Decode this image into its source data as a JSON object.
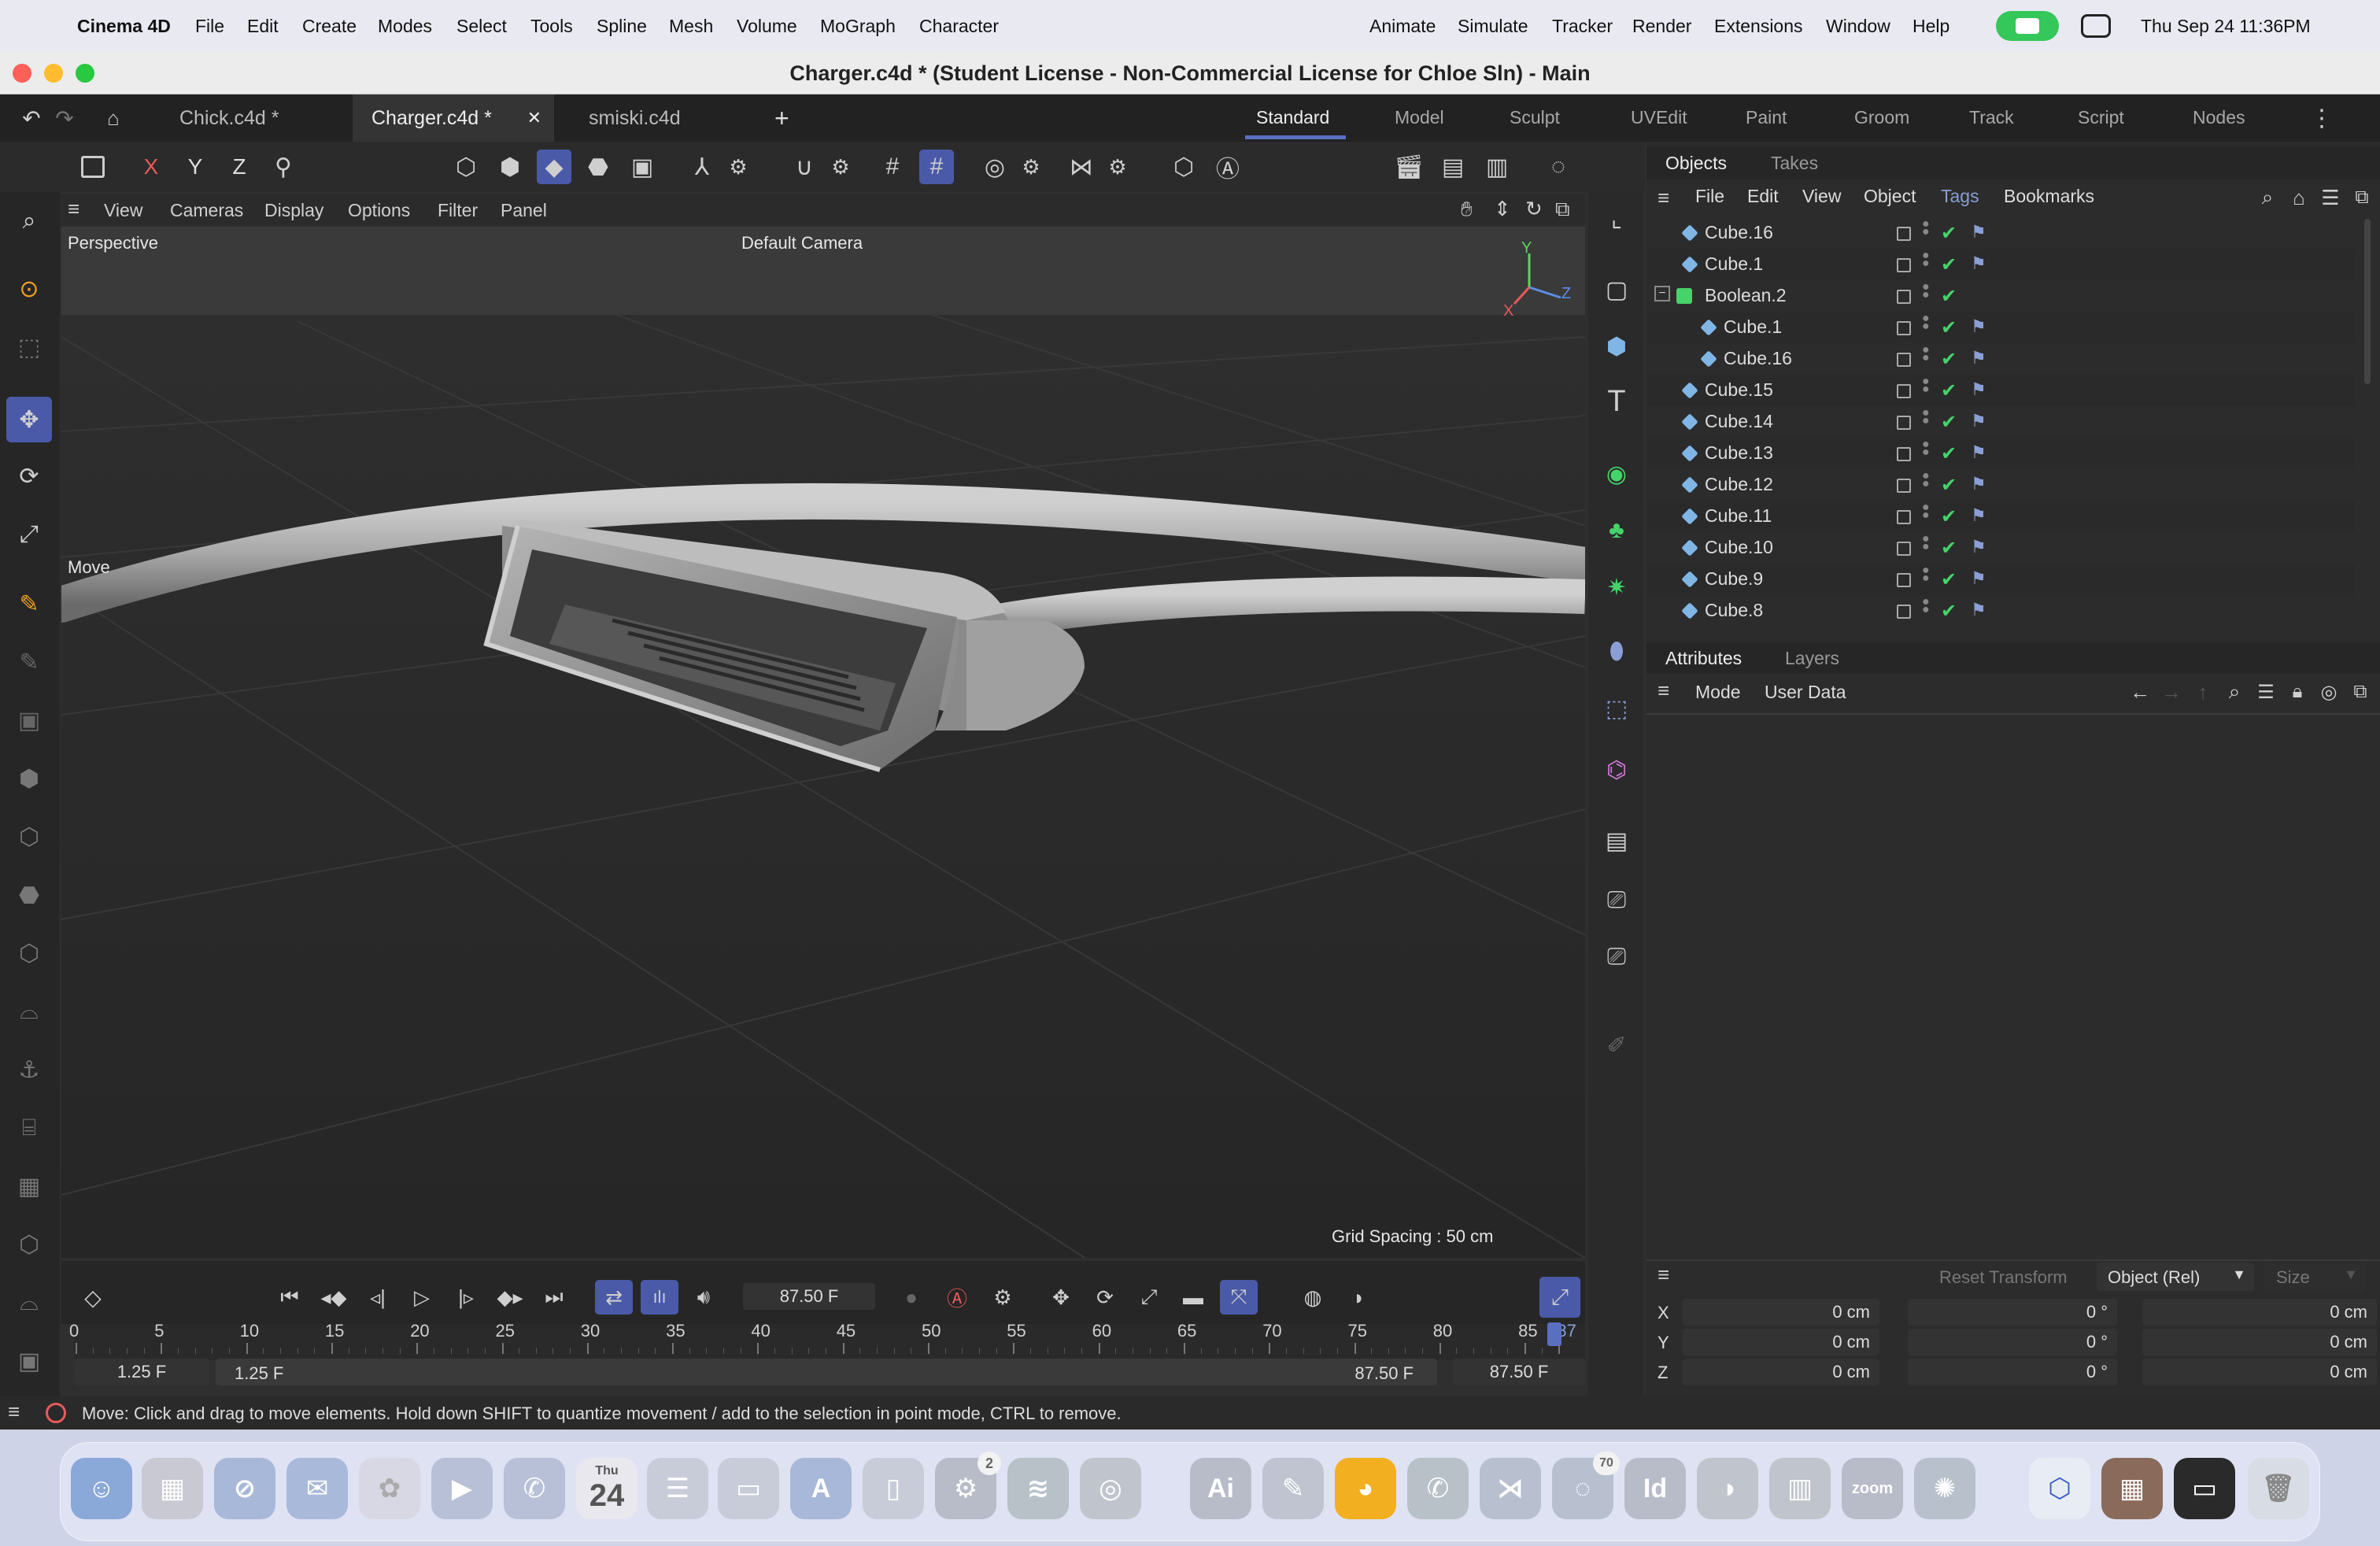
{
  "menubar": {
    "app": "Cinema 4D",
    "items": [
      "File",
      "Edit",
      "Create",
      "Modes",
      "Select",
      "Tools",
      "Spline",
      "Mesh",
      "Volume",
      "MoGraph",
      "Character"
    ],
    "right_items": [
      "Animate",
      "Simulate",
      "Tracker",
      "Render",
      "Extensions",
      "Window",
      "Help"
    ],
    "datetime": "Thu Sep 24  11:36PM"
  },
  "window": {
    "title": "Charger.c4d * (Student License - Non-Commercial License for Chloe Sln) - Main"
  },
  "doc_tabs": [
    {
      "label": "Chick.c4d *"
    },
    {
      "label": "Charger.c4d *",
      "active": true,
      "close": "✕"
    },
    {
      "label": "smiski.c4d"
    }
  ],
  "add_tab": "+",
  "layouts": [
    "Standard",
    "Model",
    "Sculpt",
    "UVEdit",
    "Paint",
    "Groom",
    "Track",
    "Script",
    "Nodes"
  ],
  "toolbar": {
    "x": "X",
    "y": "Y",
    "z": "Z"
  },
  "viewport_menu": [
    "View",
    "Cameras",
    "Display",
    "Options",
    "Filter",
    "Panel"
  ],
  "viewport": {
    "projection": "Perspective",
    "camera": "Default Camera",
    "tool_label": "Move",
    "grid_spacing": "Grid Spacing : 50 cm",
    "axes": {
      "y": "Y",
      "z": "Z",
      "x": "X"
    }
  },
  "objects_panel": {
    "tabs": [
      "Objects",
      "Takes"
    ],
    "menu": [
      "File",
      "Edit",
      "View",
      "Object",
      "Tags",
      "Bookmarks"
    ],
    "rows": [
      {
        "name": "Cube.16",
        "indent": 0
      },
      {
        "name": "Cube.1",
        "indent": 0
      },
      {
        "name": "Boolean.2",
        "indent": 0,
        "type": "boolean"
      },
      {
        "name": "Cube.1",
        "indent": 1
      },
      {
        "name": "Cube.16",
        "indent": 1
      },
      {
        "name": "Cube.15",
        "indent": 0
      },
      {
        "name": "Cube.14",
        "indent": 0
      },
      {
        "name": "Cube.13",
        "indent": 0
      },
      {
        "name": "Cube.12",
        "indent": 0
      },
      {
        "name": "Cube.11",
        "indent": 0
      },
      {
        "name": "Cube.10",
        "indent": 0
      },
      {
        "name": "Cube.9",
        "indent": 0
      },
      {
        "name": "Cube.8",
        "indent": 0
      }
    ]
  },
  "attributes_panel": {
    "tabs": [
      "Attributes",
      "Layers"
    ],
    "menu": [
      "Mode",
      "User Data"
    ]
  },
  "coords": {
    "reset": "Reset Transform",
    "mode": "Object (Rel)",
    "size": "Size",
    "rows": [
      {
        "axis": "X",
        "pos": "0 cm",
        "rot": "0 °",
        "size": "0 cm"
      },
      {
        "axis": "Y",
        "pos": "0 cm",
        "rot": "0 °",
        "size": "0 cm"
      },
      {
        "axis": "Z",
        "pos": "0 cm",
        "rot": "0 °",
        "size": "0 cm"
      }
    ]
  },
  "timeline": {
    "current_frame": "87.50 F",
    "ticks": [
      "0",
      "5",
      "10",
      "15",
      "20",
      "25",
      "30",
      "35",
      "40",
      "45",
      "50",
      "55",
      "60",
      "65",
      "70",
      "75",
      "80",
      "85",
      "87"
    ],
    "start": "1.25 F",
    "start2": "1.25 F",
    "end": "87.50 F",
    "end2": "87.50 F"
  },
  "status": {
    "message": "Move: Click and drag to move elements. Hold down SHIFT to quantize movement / add to the selection in point mode, CTRL to remove."
  },
  "dock": {
    "calendar_month": "Thu",
    "calendar_day": "24",
    "settings_badge": "2",
    "messages_badge": "70",
    "ai_label": "Ai",
    "id_label": "Id",
    "zoom_label": "zoom"
  },
  "colors": {
    "accent": "#5a6fc0",
    "check": "#46d36a",
    "bg": "#2f2f2f"
  }
}
